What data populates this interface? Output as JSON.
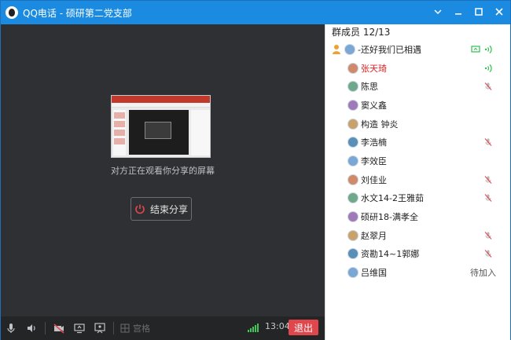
{
  "window": {
    "title": "QQ电话 - 硕研第二党支部"
  },
  "stage": {
    "hint": "对方正在观看你分享的屏幕",
    "end_share_label": "结束分享"
  },
  "bottombar": {
    "grid_label": "宫格",
    "time": "13:04",
    "exit_label": "退出",
    "accent": "#e0474c",
    "signal_color": "#46c35a"
  },
  "panel": {
    "header": "群成员 12/13",
    "members": [
      {
        "name": "-还好我们已相遇",
        "host": true,
        "status": "speaking-share"
      },
      {
        "name": "张天琦",
        "red": true,
        "status": "speaking"
      },
      {
        "name": "陈思",
        "status": "muted"
      },
      {
        "name": "窦义鑫",
        "status": ""
      },
      {
        "name": "构造   钟炎",
        "status": ""
      },
      {
        "name": "李浩楠",
        "status": "muted"
      },
      {
        "name": "李效臣",
        "status": ""
      },
      {
        "name": "刘佳业",
        "status": "muted"
      },
      {
        "name": "水文14-2王雅茹",
        "status": "muted"
      },
      {
        "name": "硕研18-满孝全",
        "status": ""
      },
      {
        "name": "赵翠月",
        "status": "muted"
      },
      {
        "name": "资勘14~1郭娜",
        "status": "muted"
      },
      {
        "name": "吕维国",
        "status": "pending",
        "pending_label": "待加入"
      }
    ]
  },
  "colors": {
    "titlebar": "#1a8be0",
    "stage": "#2e3033",
    "speaking": "#2fbf4f"
  }
}
